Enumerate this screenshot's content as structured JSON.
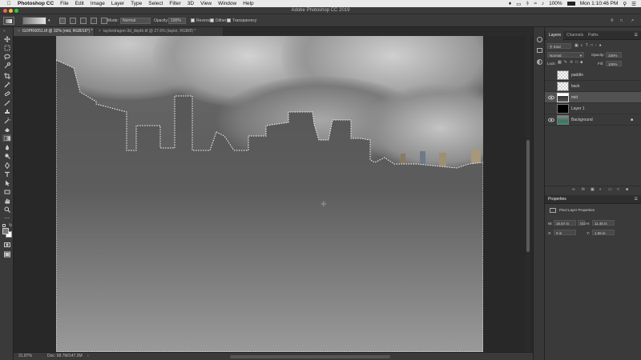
{
  "menubar": {
    "app": "Photoshop CC",
    "items": [
      "File",
      "Edit",
      "Image",
      "Layer",
      "Type",
      "Select",
      "Filter",
      "3D",
      "View",
      "Window",
      "Help"
    ],
    "battery": "100%",
    "clock": "Mon 1:10:46 PM"
  },
  "window": {
    "title": "Adobe Photoshop CC 2019"
  },
  "options": {
    "mode_label": "Mode:",
    "mode_value": "Normal",
    "opacity_label": "Opacity:",
    "opacity_value": "100%",
    "reverse": "Reverse",
    "dither": "Dither",
    "transparency": "Transparency"
  },
  "tabs": [
    {
      "label": "GOPR0051.tif @ 32% (mid, RGB/16*) *",
      "active": true
    },
    {
      "label": "taylordragon-3d_depth.tif @ 27.6% (taylor, RGB/8) *",
      "active": false
    }
  ],
  "status": {
    "zoom": "31.87%",
    "doc": "Doc: 98.7M/147.3M"
  },
  "layers_panel": {
    "tabs": [
      "Layers",
      "Channels",
      "Paths"
    ],
    "kind_label": "Kind",
    "blend_mode": "Normal",
    "opacity_label": "Opacity:",
    "opacity_value": "100%",
    "lock_label": "Lock:",
    "fill_label": "Fill:",
    "fill_value": "100%",
    "layers": [
      {
        "name": "paddle",
        "visible": false,
        "thumb": "transparent",
        "selected": false
      },
      {
        "name": "back",
        "visible": false,
        "thumb": "transparent",
        "selected": false
      },
      {
        "name": "mid",
        "visible": true,
        "thumb": "mid",
        "selected": true
      },
      {
        "name": "Layer 1",
        "visible": false,
        "thumb": "black",
        "selected": false
      },
      {
        "name": "Background",
        "visible": true,
        "thumb": "photo",
        "selected": false,
        "locked": true
      }
    ]
  },
  "properties_panel": {
    "title": "Properties",
    "subtitle": "Pixel Layer Properties",
    "w_label": "W:",
    "w_value": "16.67 in",
    "h_label": "H:",
    "h_value": "11.45 in",
    "x_label": "X:",
    "x_value": "0 in",
    "y_label": "Y:",
    "y_value": "1.65 in",
    "link_label": "GO"
  }
}
